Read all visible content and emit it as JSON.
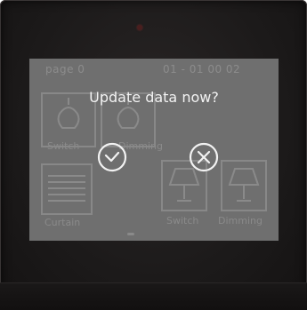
{
  "status_bar": {
    "page_label": "page 0",
    "datetime": "01 - 01  00   02"
  },
  "tiles": [
    {
      "label": "Switch",
      "icon": "lamp-icon"
    },
    {
      "label": "Dimming",
      "icon": "lamp-icon"
    },
    {
      "label": "Curtain",
      "icon": "curtain-icon"
    },
    {
      "label": "Switch",
      "icon": "table-lamp-icon"
    },
    {
      "label": "Dimming",
      "icon": "table-lamp-icon"
    }
  ],
  "dialog": {
    "title": "Update data now?",
    "confirm_icon": "check-circle-icon",
    "cancel_icon": "close-circle-icon"
  },
  "colors": {
    "screen_bg": "#6f6f6f",
    "dialog_text": "#f2f2f2",
    "bezel": "#1c1a1a"
  }
}
